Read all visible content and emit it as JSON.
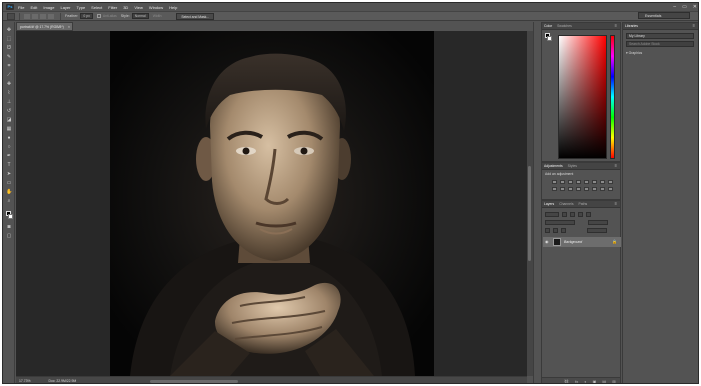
{
  "app": {
    "logo": "Ps",
    "menu": [
      "File",
      "Edit",
      "Image",
      "Layer",
      "Type",
      "Select",
      "Filter",
      "3D",
      "View",
      "Window",
      "Help"
    ],
    "window_controls": [
      "–",
      "▭",
      "✕"
    ]
  },
  "options_bar": {
    "feather_label": "Feather:",
    "feather_value": "0 px",
    "antialias_label": "Anti-alias",
    "style_label": "Style:",
    "style_value": "Normal",
    "width_label": "Width:",
    "select_mask_button": "Select and Mask...",
    "workspace": "Essentials"
  },
  "document": {
    "tab_title": "portrait.tif @ 17.7% (RGB/8*)",
    "close": "×",
    "zoom": "17.73%",
    "doc_info": "Doc: 22.9M/22.9M"
  },
  "panels": {
    "color": {
      "tabs": [
        "Color",
        "Swatches"
      ],
      "fg_color": "#000000",
      "bg_color": "#ffffff",
      "hue_color": "#ff0000"
    },
    "adjustments": {
      "tabs": [
        "Adjustments",
        "Styles"
      ],
      "title": "Add an adjustment"
    },
    "layers": {
      "tabs": [
        "Layers",
        "Channels",
        "Paths"
      ],
      "layer_name": "Background",
      "bottom_icons": [
        "⛓",
        "fx",
        "◐",
        "▣",
        "▤",
        "⊞",
        "🗑"
      ]
    },
    "libraries": {
      "tabs": [
        "Libraries"
      ],
      "library": "My Library",
      "search_placeholder": "Search Adobe Stock",
      "section": "Graphics"
    }
  },
  "colors": {
    "ui_gray": "#535353",
    "dark_gray": "#282828",
    "accent": "#31a8ff"
  }
}
